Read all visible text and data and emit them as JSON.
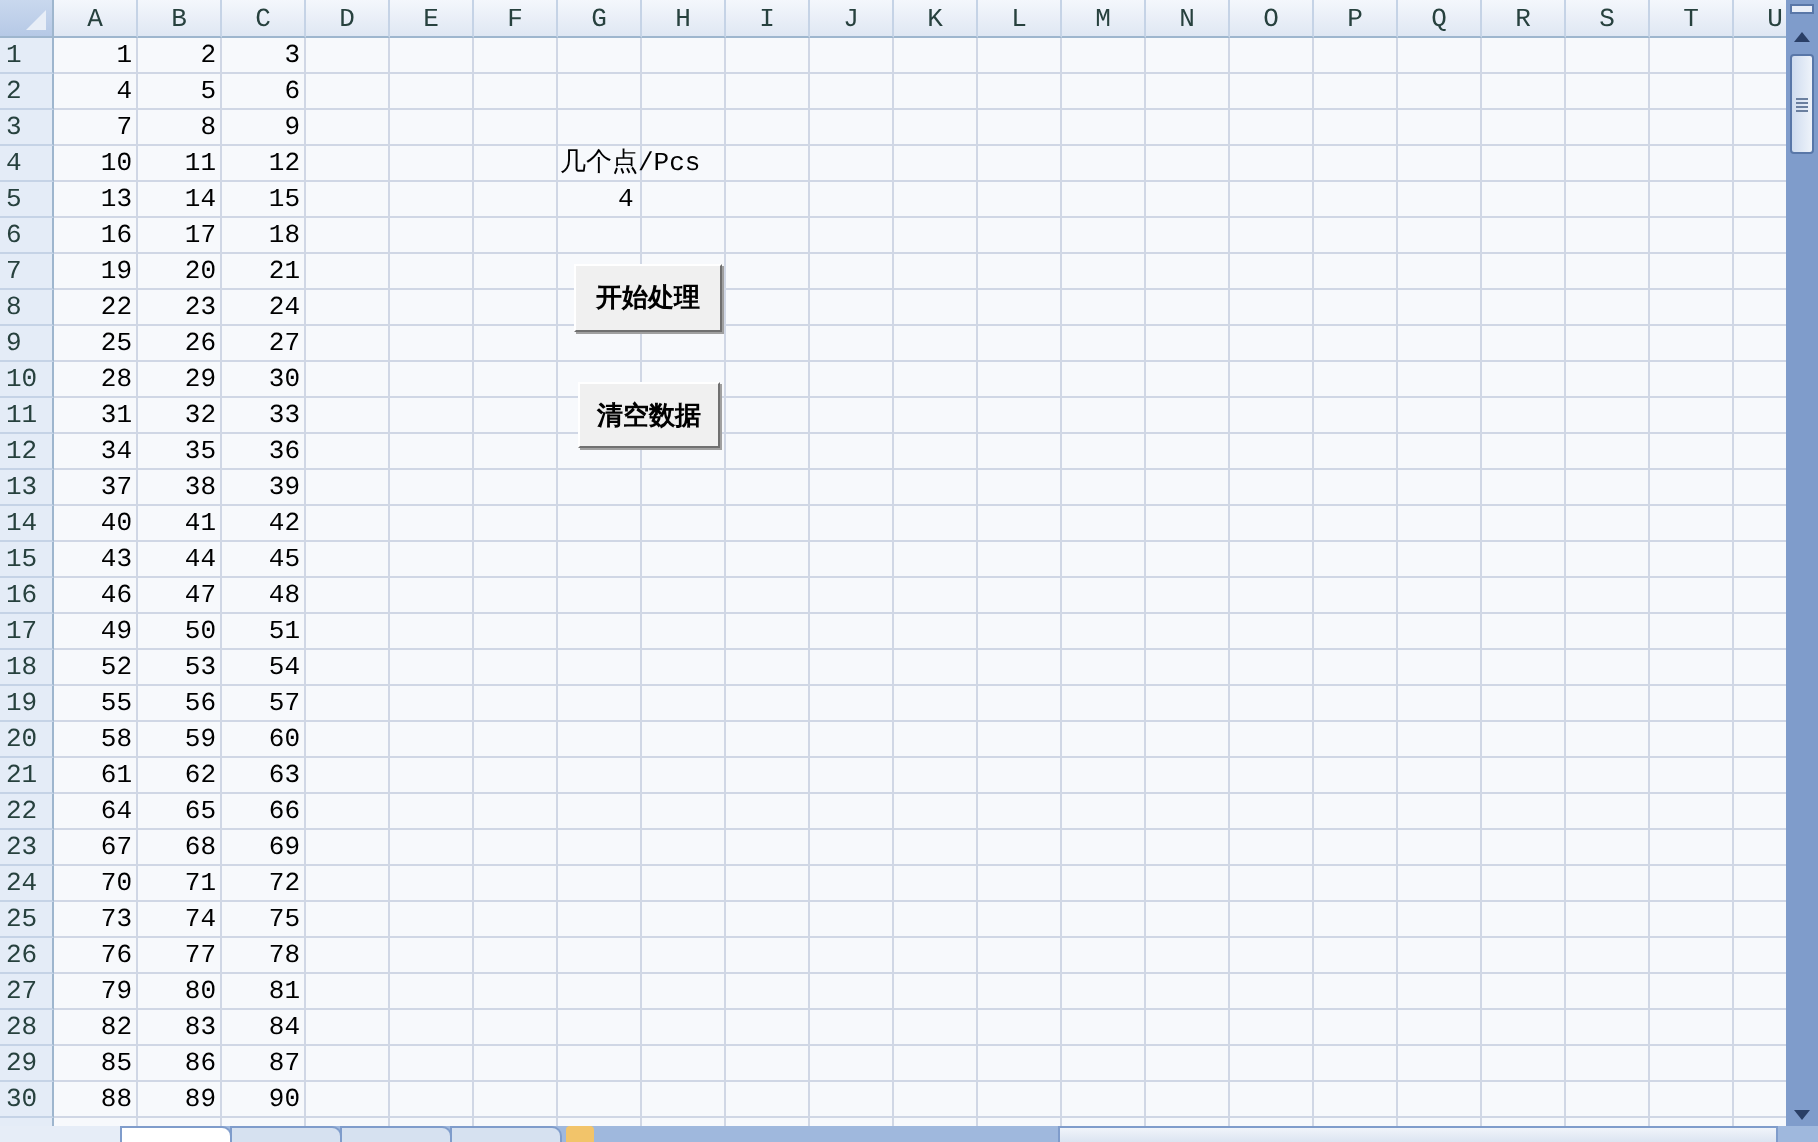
{
  "columns": [
    "A",
    "B",
    "C",
    "D",
    "E",
    "F",
    "G",
    "H",
    "I",
    "J",
    "K",
    "L",
    "M",
    "N",
    "O",
    "P",
    "Q",
    "R",
    "S",
    "T",
    "U"
  ],
  "rows": [
    {
      "header": "1",
      "cells": [
        "1",
        "2",
        "3"
      ]
    },
    {
      "header": "2",
      "cells": [
        "4",
        "5",
        "6"
      ]
    },
    {
      "header": "3",
      "cells": [
        "7",
        "8",
        "9"
      ]
    },
    {
      "header": "4",
      "cells": [
        "10",
        "11",
        "12"
      ]
    },
    {
      "header": "5",
      "cells": [
        "13",
        "14",
        "15"
      ]
    },
    {
      "header": "6",
      "cells": [
        "16",
        "17",
        "18"
      ]
    },
    {
      "header": "7",
      "cells": [
        "19",
        "20",
        "21"
      ]
    },
    {
      "header": "8",
      "cells": [
        "22",
        "23",
        "24"
      ]
    },
    {
      "header": "9",
      "cells": [
        "25",
        "26",
        "27"
      ]
    },
    {
      "header": "10",
      "cells": [
        "28",
        "29",
        "30"
      ]
    },
    {
      "header": "11",
      "cells": [
        "31",
        "32",
        "33"
      ]
    },
    {
      "header": "12",
      "cells": [
        "34",
        "35",
        "36"
      ]
    },
    {
      "header": "13",
      "cells": [
        "37",
        "38",
        "39"
      ]
    },
    {
      "header": "14",
      "cells": [
        "40",
        "41",
        "42"
      ]
    },
    {
      "header": "15",
      "cells": [
        "43",
        "44",
        "45"
      ]
    },
    {
      "header": "16",
      "cells": [
        "46",
        "47",
        "48"
      ]
    },
    {
      "header": "17",
      "cells": [
        "49",
        "50",
        "51"
      ]
    },
    {
      "header": "18",
      "cells": [
        "52",
        "53",
        "54"
      ]
    },
    {
      "header": "19",
      "cells": [
        "55",
        "56",
        "57"
      ]
    },
    {
      "header": "20",
      "cells": [
        "58",
        "59",
        "60"
      ]
    },
    {
      "header": "21",
      "cells": [
        "61",
        "62",
        "63"
      ]
    },
    {
      "header": "22",
      "cells": [
        "64",
        "65",
        "66"
      ]
    },
    {
      "header": "23",
      "cells": [
        "67",
        "68",
        "69"
      ]
    },
    {
      "header": "24",
      "cells": [
        "70",
        "71",
        "72"
      ]
    },
    {
      "header": "25",
      "cells": [
        "73",
        "74",
        "75"
      ]
    },
    {
      "header": "26",
      "cells": [
        "76",
        "77",
        "78"
      ]
    },
    {
      "header": "27",
      "cells": [
        "79",
        "80",
        "81"
      ]
    },
    {
      "header": "28",
      "cells": [
        "82",
        "83",
        "84"
      ]
    },
    {
      "header": "29",
      "cells": [
        "85",
        "86",
        "87"
      ]
    },
    {
      "header": "30",
      "cells": [
        "88",
        "89",
        "90"
      ]
    }
  ],
  "label_cell": "几个点/Pcs",
  "value_cell": "4",
  "buttons": [
    {
      "label": "开始处理"
    },
    {
      "label": "清空数据"
    }
  ],
  "sheet_tabs": [
    {
      "selected": true
    },
    {
      "selected": false
    },
    {
      "selected": false
    },
    {
      "selected": false
    }
  ]
}
